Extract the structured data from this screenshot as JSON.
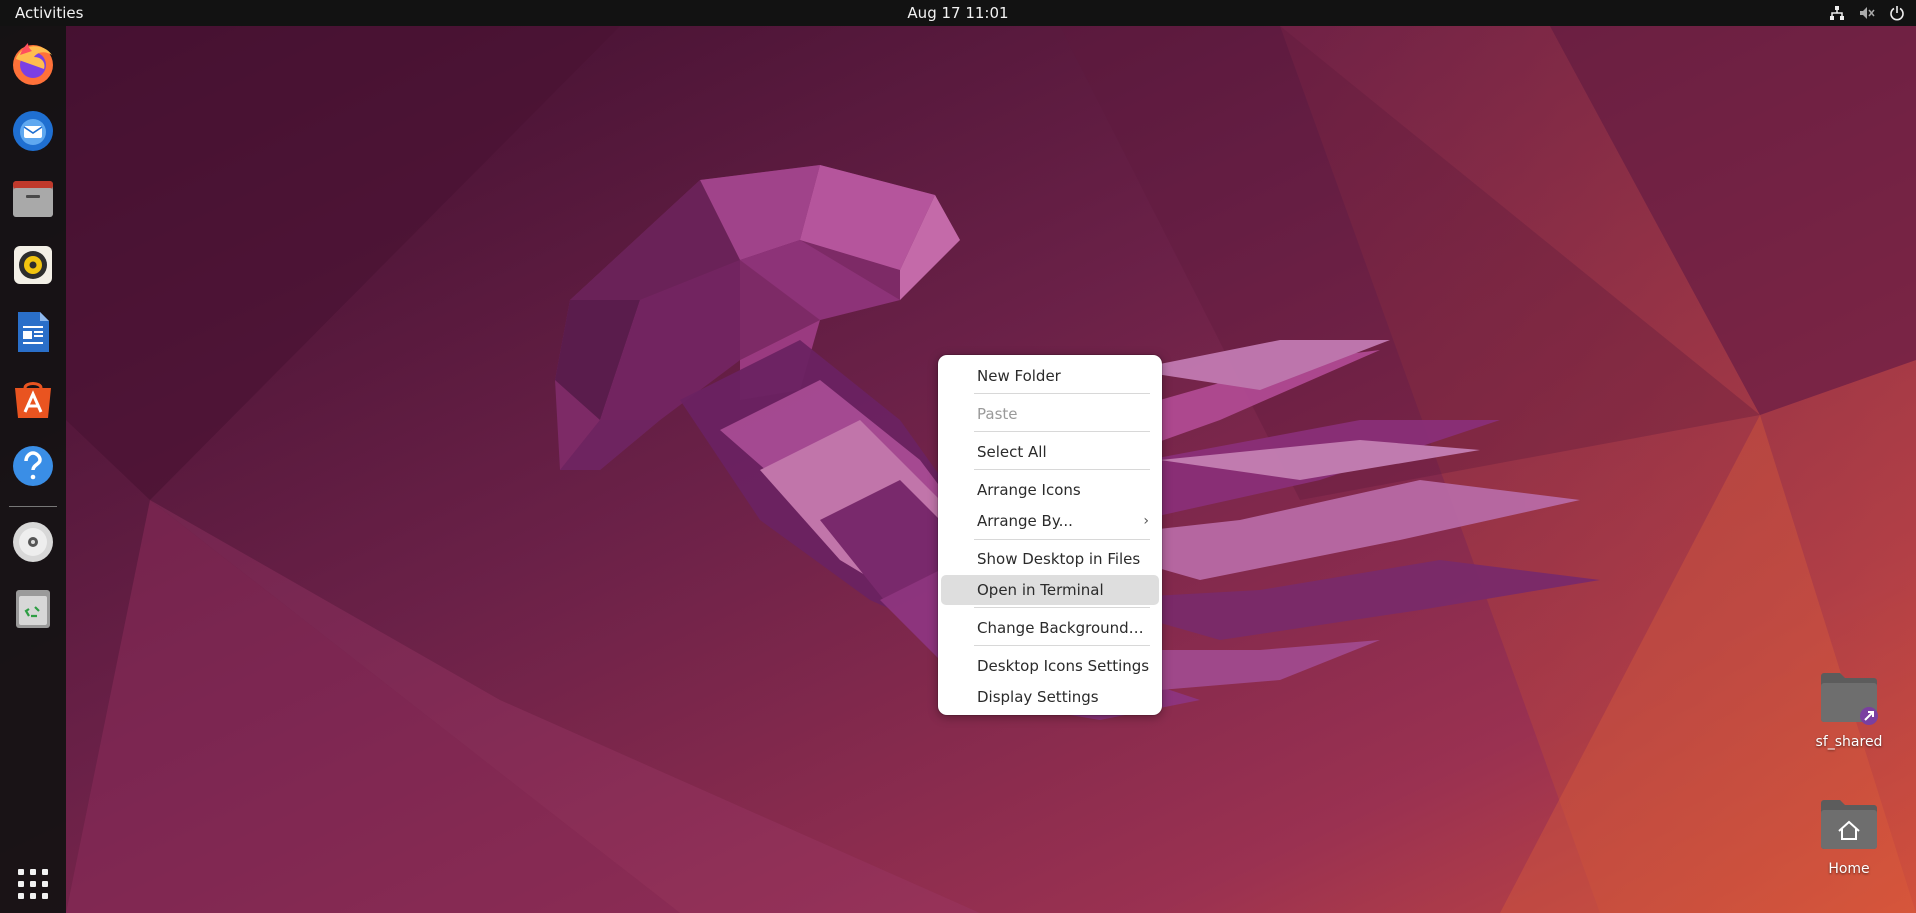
{
  "top_bar": {
    "activities_label": "Activities",
    "clock": "Aug 17  11:01",
    "status_icons": [
      "network-icon",
      "volume-muted-icon",
      "power-icon"
    ]
  },
  "dock": {
    "items": [
      {
        "name": "Firefox",
        "icon": "firefox-icon"
      },
      {
        "name": "Thunderbird",
        "icon": "thunderbird-icon"
      },
      {
        "name": "Files",
        "icon": "files-icon"
      },
      {
        "name": "Rhythmbox",
        "icon": "rhythmbox-icon"
      },
      {
        "name": "LibreOffice Writer",
        "icon": "writer-icon"
      },
      {
        "name": "Ubuntu Software",
        "icon": "software-icon"
      },
      {
        "name": "Help",
        "icon": "help-icon"
      },
      {
        "name": "Disc",
        "icon": "disc-icon"
      },
      {
        "name": "Trash",
        "icon": "trash-icon"
      }
    ],
    "show_apps_icon": "app-grid-icon"
  },
  "desktop_icons": [
    {
      "label": "sf_shared",
      "icon": "folder-link-icon"
    },
    {
      "label": "Home",
      "icon": "home-folder-icon"
    }
  ],
  "context_menu": {
    "items": [
      {
        "label": "New Folder",
        "enabled": true
      },
      {
        "label": "Paste",
        "enabled": false
      },
      {
        "label": "Select All",
        "enabled": true
      },
      {
        "label": "Arrange Icons",
        "enabled": true
      },
      {
        "label": "Arrange By...",
        "enabled": true,
        "submenu": true
      },
      {
        "label": "Show Desktop in Files",
        "enabled": true
      },
      {
        "label": "Open in Terminal",
        "enabled": true,
        "highlighted": true
      },
      {
        "label": "Change Background…",
        "enabled": true
      },
      {
        "label": "Desktop Icons Settings",
        "enabled": true
      },
      {
        "label": "Display Settings",
        "enabled": true
      }
    ],
    "submenu_chevron": "›"
  },
  "colors": {
    "top_bar": "#121212",
    "dock": "#121212",
    "menu_bg": "#ffffff",
    "menu_highlight": "#dedede",
    "ubuntu_orange": "#e95420"
  }
}
